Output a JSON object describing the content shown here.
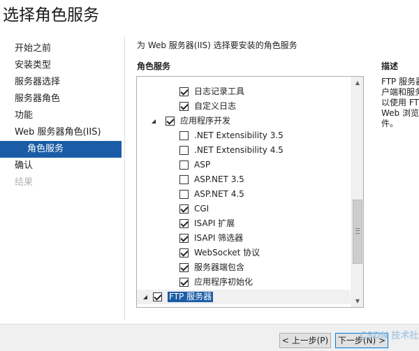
{
  "window": {
    "title": "选择角色服务"
  },
  "nav": {
    "items": [
      {
        "label": "开始之前"
      },
      {
        "label": "安装类型"
      },
      {
        "label": "服务器选择"
      },
      {
        "label": "服务器角色"
      },
      {
        "label": "功能"
      },
      {
        "label": "Web 服务器角色(IIS)"
      },
      {
        "label": "角色服务",
        "state": "active"
      },
      {
        "label": "确认"
      },
      {
        "label": "结果",
        "state": "disabled"
      }
    ]
  },
  "main": {
    "instruction": "为 Web 服务器(IIS) 选择要安装的角色服务",
    "list_header": "角色服务",
    "description_header": "描述",
    "description_lines": [
      "FTP 服务器",
      "户端和服务",
      "以使用 FT",
      "Web 浏览",
      "件。"
    ]
  },
  "tree": {
    "rows": [
      {
        "label": "日志记录工具",
        "checked": true,
        "level": 2
      },
      {
        "label": "自定义日志",
        "checked": true,
        "level": 2
      },
      {
        "label": "应用程序开发",
        "checked": true,
        "level": 1,
        "expander": "expanded"
      },
      {
        "label": ".NET Extensibility 3.5",
        "checked": false,
        "level": 2
      },
      {
        "label": ".NET Extensibility 4.5",
        "checked": false,
        "level": 2
      },
      {
        "label": "ASP",
        "checked": false,
        "level": 2
      },
      {
        "label": "ASP.NET 3.5",
        "checked": false,
        "level": 2
      },
      {
        "label": "ASP.NET 4.5",
        "checked": false,
        "level": 2
      },
      {
        "label": "CGI",
        "checked": true,
        "level": 2
      },
      {
        "label": "ISAPI 扩展",
        "checked": true,
        "level": 2
      },
      {
        "label": "ISAPI 筛选器",
        "checked": true,
        "level": 2
      },
      {
        "label": "WebSocket 协议",
        "checked": true,
        "level": 2
      },
      {
        "label": "服务器端包含",
        "checked": true,
        "level": 2
      },
      {
        "label": "应用程序初始化",
        "checked": true,
        "level": 2
      },
      {
        "label": "FTP 服务器",
        "checked": true,
        "level": 0,
        "expander": "expanded",
        "selected": true
      }
    ],
    "scrollbar": {
      "position": 0.55
    }
  },
  "footer": {
    "prev_label": "< 上一步(P)",
    "next_label": "下一步(N) >"
  },
  "watermark": "CSDN 技术社区",
  "colors": {
    "accent": "#1a5da6",
    "selected_row": "#f0f0f0",
    "footer_bg": "#f0f0f0",
    "disabled_text": "#b4b4b4"
  },
  "icons": {
    "expanded": "expand-arrow-icon",
    "checkbox": "checkbox-icon"
  }
}
